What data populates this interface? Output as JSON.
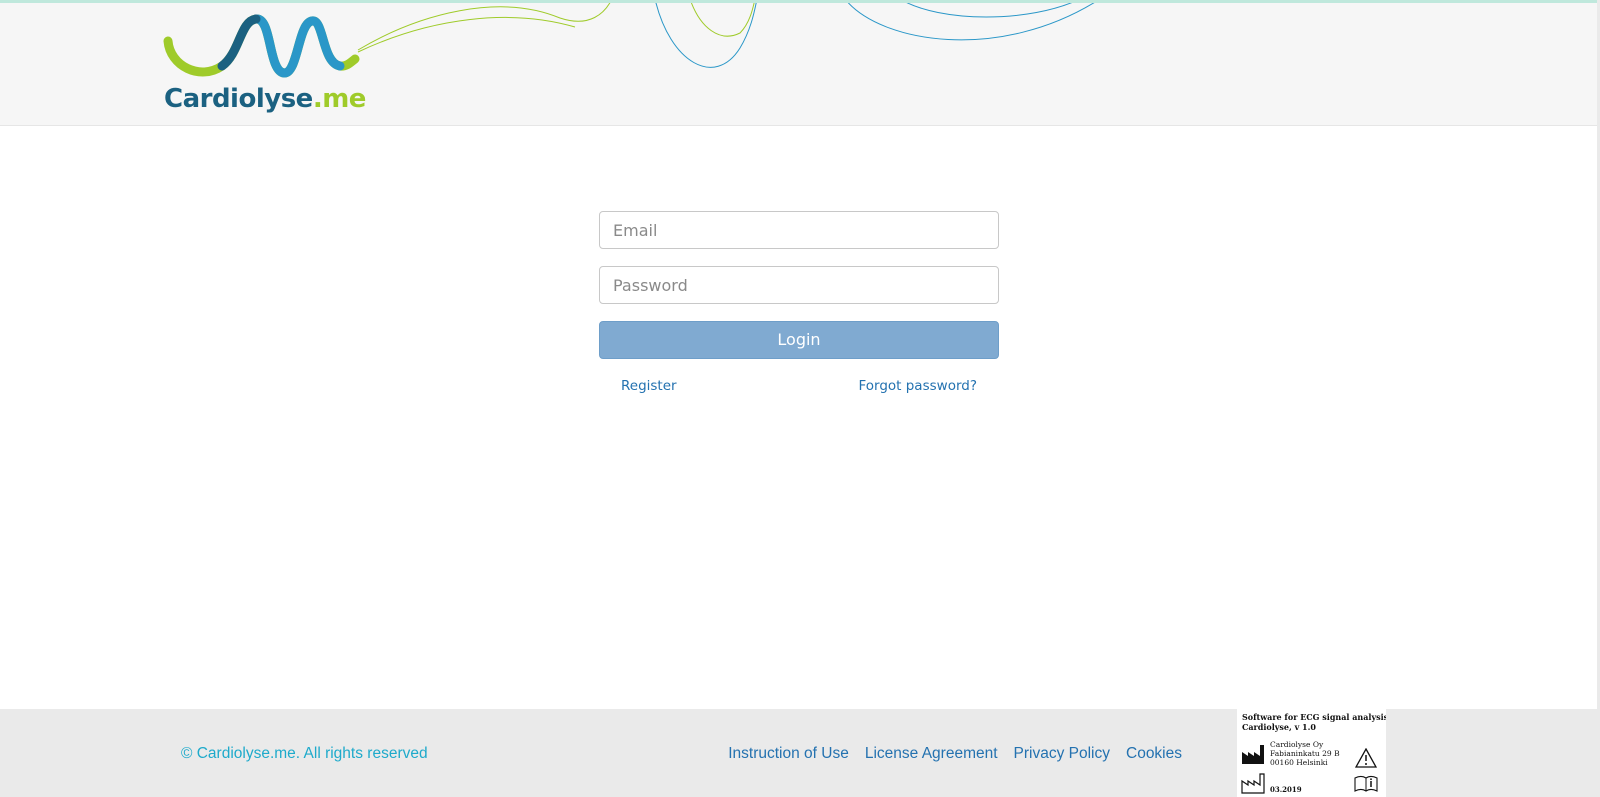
{
  "header": {
    "logo": {
      "name": "Cardiolyse",
      "tld": ".me",
      "colors": {
        "navy": "#1b6181",
        "green": "#9fcb2a",
        "blue": "#2a97c8"
      }
    }
  },
  "login": {
    "email_placeholder": "Email",
    "password_placeholder": "Password",
    "login_label": "Login",
    "register_label": "Register",
    "forgot_label": "Forgot password?",
    "button_color": "#80aad1",
    "link_color": "#2472b0"
  },
  "footer": {
    "copyright": "© Cardiolyse.me. All rights reserved",
    "links": [
      {
        "label": "Instruction of Use"
      },
      {
        "label": "License Agreement"
      },
      {
        "label": "Privacy Policy"
      },
      {
        "label": "Cookies"
      }
    ],
    "device_label": {
      "title_line1": "Software for ECG signal analysis",
      "title_line2": "Cardiolyse, v 1.0",
      "manufacturer": "Cardiolyse Oy",
      "street": "Fabianinkatu 29 B",
      "city": "00160 Helsinki",
      "date": "03.2019",
      "icons": [
        "manufacturer-icon",
        "warning-icon",
        "manufacture-date-icon",
        "instructions-icon"
      ]
    }
  }
}
